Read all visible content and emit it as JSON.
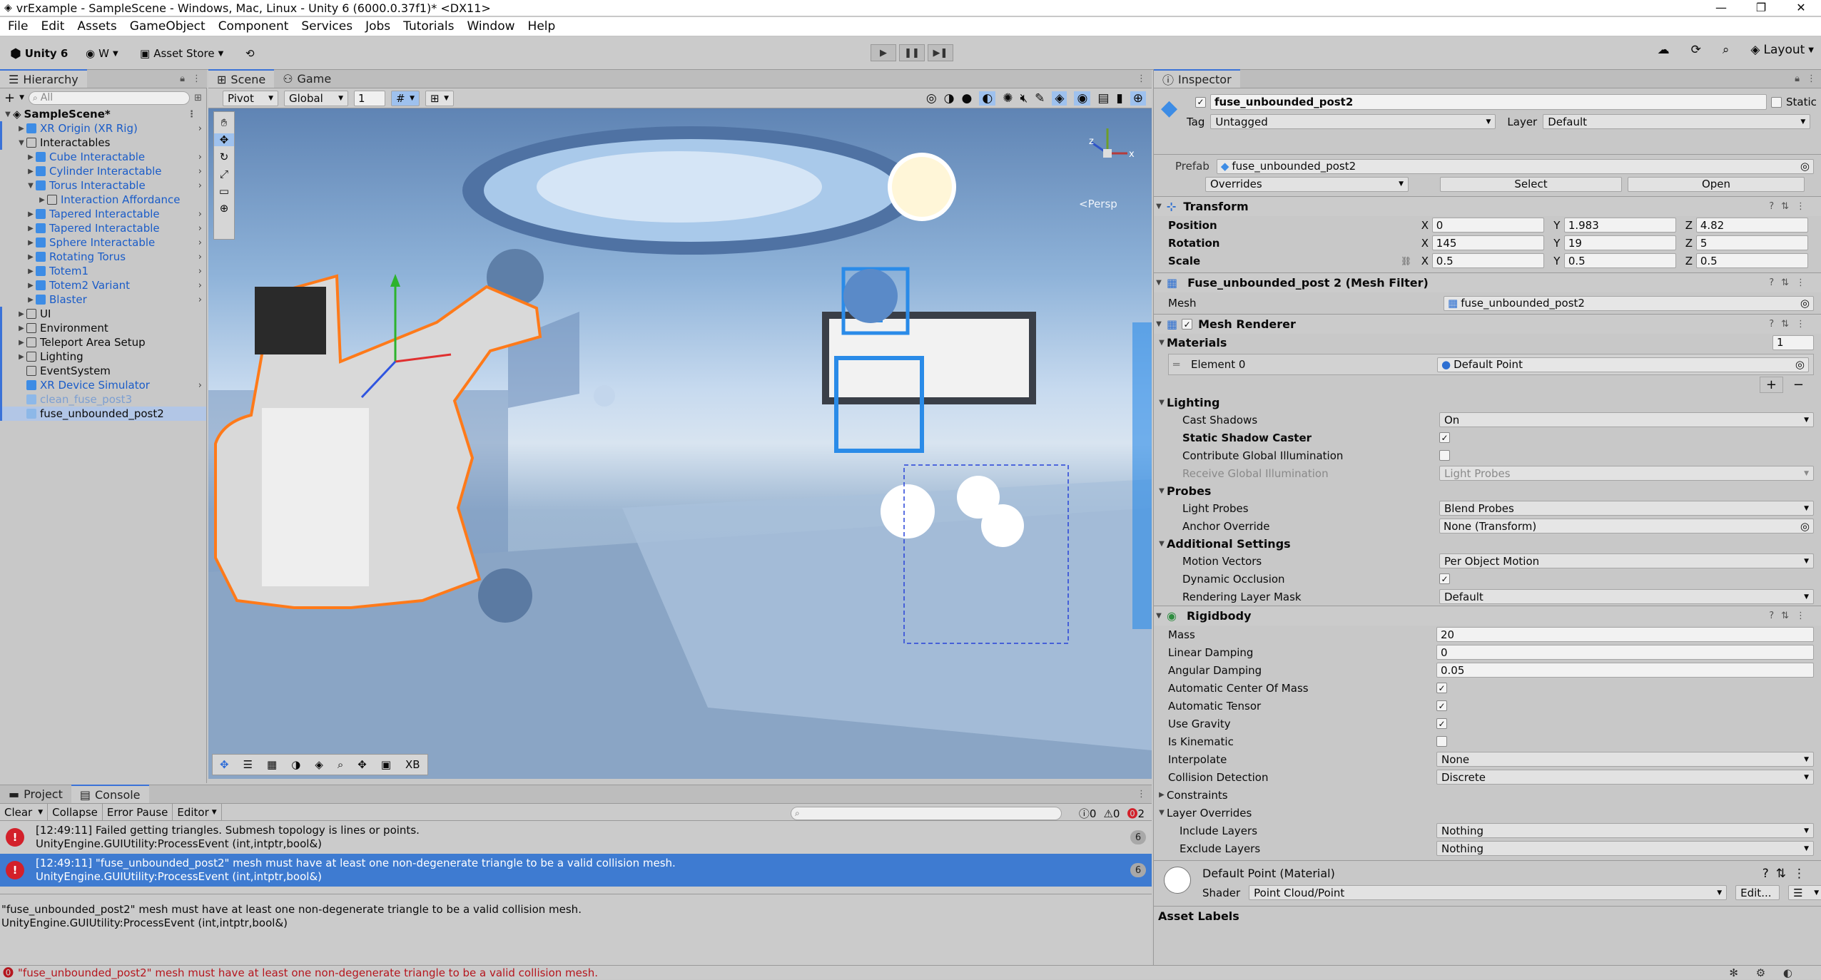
{
  "window": {
    "title": "vrExample - SampleScene - Windows, Mac, Linux - Unity 6 (6000.0.37f1)* <DX11>",
    "min": "—",
    "restore": "❐",
    "close": "✕"
  },
  "menu": [
    "File",
    "Edit",
    "Assets",
    "GameObject",
    "Component",
    "Services",
    "Jobs",
    "Tutorials",
    "Window",
    "Help"
  ],
  "toolbar": {
    "unity": "Unity 6",
    "account": "W",
    "asset_store": "Asset Store",
    "layout": "Layout"
  },
  "hierarchy": {
    "tab": "Hierarchy",
    "search_placeholder": "All",
    "scene": "SampleScene*",
    "rows": [
      {
        "label": "XR Origin (XR Rig)",
        "indent": 1,
        "arrow": "▶",
        "icon": "prefab",
        "blue": true,
        "more": true
      },
      {
        "label": "Interactables",
        "indent": 1,
        "arrow": "▼",
        "icon": "go",
        "blue": false,
        "more": false
      },
      {
        "label": "Cube Interactable",
        "indent": 2,
        "arrow": "▶",
        "icon": "prefab",
        "blue": true,
        "more": true
      },
      {
        "label": "Cylinder Interactable",
        "indent": 2,
        "arrow": "▶",
        "icon": "prefab",
        "blue": true,
        "more": true
      },
      {
        "label": "Torus Interactable",
        "indent": 2,
        "arrow": "▼",
        "icon": "prefab",
        "blue": true,
        "more": true
      },
      {
        "label": "Interaction Affordance",
        "indent": 3,
        "arrow": "▶",
        "icon": "go",
        "blue": true,
        "more": false
      },
      {
        "label": "Tapered Interactable",
        "indent": 2,
        "arrow": "▶",
        "icon": "prefab",
        "blue": true,
        "more": true
      },
      {
        "label": "Tapered Interactable",
        "indent": 2,
        "arrow": "▶",
        "icon": "prefab",
        "blue": true,
        "more": true
      },
      {
        "label": "Sphere Interactable",
        "indent": 2,
        "arrow": "▶",
        "icon": "prefab",
        "blue": true,
        "more": true
      },
      {
        "label": "Rotating Torus",
        "indent": 2,
        "arrow": "▶",
        "icon": "prefab",
        "blue": true,
        "more": true
      },
      {
        "label": "Totem1",
        "indent": 2,
        "arrow": "▶",
        "icon": "prefab",
        "blue": true,
        "more": true
      },
      {
        "label": "Totem2 Variant",
        "indent": 2,
        "arrow": "▶",
        "icon": "prefab",
        "blue": true,
        "more": true
      },
      {
        "label": "Blaster",
        "indent": 2,
        "arrow": "▶",
        "icon": "prefab",
        "blue": true,
        "more": true
      },
      {
        "label": "UI",
        "indent": 1,
        "arrow": "▶",
        "icon": "go",
        "blue": false,
        "more": false
      },
      {
        "label": "Environment",
        "indent": 1,
        "arrow": "▶",
        "icon": "go",
        "blue": false,
        "more": false
      },
      {
        "label": "Teleport Area Setup",
        "indent": 1,
        "arrow": "▶",
        "icon": "go",
        "blue": false,
        "more": false
      },
      {
        "label": "Lighting",
        "indent": 1,
        "arrow": "▶",
        "icon": "go",
        "blue": false,
        "more": false
      },
      {
        "label": "EventSystem",
        "indent": 1,
        "arrow": "",
        "icon": "go",
        "blue": false,
        "more": false
      },
      {
        "label": "XR Device Simulator",
        "indent": 1,
        "arrow": "",
        "icon": "prefab",
        "blue": true,
        "more": true
      },
      {
        "label": "clean_fuse_post3",
        "indent": 1,
        "arrow": "",
        "icon": "fade",
        "blue": true,
        "more": false,
        "faded": true
      },
      {
        "label": "fuse_unbounded_post2",
        "indent": 1,
        "arrow": "",
        "icon": "fade",
        "blue": false,
        "more": false,
        "selected": true
      }
    ]
  },
  "scene": {
    "tab_scene": "Scene",
    "tab_game": "Game",
    "pivot": "Pivot",
    "global": "Global",
    "grid_value": "1",
    "persp": "<Persp",
    "overlay_label": "XB"
  },
  "console": {
    "tab_project": "Project",
    "tab_console": "Console",
    "clear": "Clear",
    "collapse": "Collapse",
    "error_pause": "Error Pause",
    "editor": "Editor",
    "count_info": "0",
    "count_warn": "0",
    "count_err": "2",
    "entries": [
      {
        "line1": "[12:49:11] Failed getting triangles. Submesh topology is lines or points.",
        "line2": "UnityEngine.GUIUtility:ProcessEvent (int,intptr,bool&)",
        "count": "6",
        "selected": false
      },
      {
        "line1": "[12:49:11] \"fuse_unbounded_post2\" mesh must have at least one non-degenerate triangle to be a valid collision mesh.",
        "line2": "UnityEngine.GUIUtility:ProcessEvent (int,intptr,bool&)",
        "count": "6",
        "selected": true
      }
    ],
    "detail1": "\"fuse_unbounded_post2\" mesh must have at least one non-degenerate triangle to be a valid collision mesh.",
    "detail2": "UnityEngine.GUIUtility:ProcessEvent (int,intptr,bool&)",
    "status": "\"fuse_unbounded_post2\" mesh must have at least one non-degenerate triangle to be a valid collision mesh."
  },
  "inspector": {
    "tab": "Inspector",
    "name": "fuse_unbounded_post2",
    "static_label": "Static",
    "tag_label": "Tag",
    "tag": "Untagged",
    "layer_label": "Layer",
    "layer": "Default",
    "prefab_label": "Prefab",
    "prefab": "fuse_unbounded_post2",
    "overrides": "Overrides",
    "select": "Select",
    "open": "Open",
    "transform": {
      "title": "Transform",
      "position_label": "Position",
      "rotation_label": "Rotation",
      "scale_label": "Scale",
      "position": [
        "0",
        "1.983",
        "4.82"
      ],
      "rotation": [
        "145",
        "19",
        "5"
      ],
      "scale": [
        "0.5",
        "0.5",
        "0.5"
      ]
    },
    "mesh_filter": {
      "title": "Fuse_unbounded_post 2 (Mesh Filter)",
      "mesh_label": "Mesh",
      "mesh": "fuse_unbounded_post2"
    },
    "mesh_renderer": {
      "title": "Mesh Renderer",
      "materials_label": "Materials",
      "materials_count": "1",
      "element_label": "Element 0",
      "element": "Default Point",
      "lighting_label": "Lighting",
      "cast_shadows_label": "Cast Shadows",
      "cast_shadows": "On",
      "static_shadow_label": "Static Shadow Caster",
      "contribute_gi_label": "Contribute Global Illumination",
      "receive_gi_label": "Receive Global Illumination",
      "receive_gi": "Light Probes",
      "probes_label": "Probes",
      "light_probes_label": "Light Probes",
      "light_probes": "Blend Probes",
      "anchor_label": "Anchor Override",
      "anchor": "None (Transform)",
      "additional_label": "Additional Settings",
      "motion_label": "Motion Vectors",
      "motion": "Per Object Motion",
      "dynamic_occ_label": "Dynamic Occlusion",
      "rendering_mask_label": "Rendering Layer Mask",
      "rendering_mask": "Default"
    },
    "rigidbody": {
      "title": "Rigidbody",
      "mass_label": "Mass",
      "mass": "20",
      "linear_label": "Linear Damping",
      "linear": "0",
      "angular_label": "Angular Damping",
      "angular": "0.05",
      "auto_com_label": "Automatic Center Of Mass",
      "auto_tensor_label": "Automatic Tensor",
      "gravity_label": "Use Gravity",
      "kinematic_label": "Is Kinematic",
      "interpolate_label": "Interpolate",
      "interpolate": "None",
      "collision_label": "Collision Detection",
      "collision": "Discrete",
      "constraints_label": "Constraints",
      "layer_overrides_label": "Layer Overrides",
      "include_label": "Include Layers",
      "include": "Nothing",
      "exclude_label": "Exclude Layers",
      "exclude": "Nothing"
    },
    "material": {
      "title": "Default Point (Material)",
      "shader_label": "Shader",
      "shader": "Point Cloud/Point",
      "edit": "Edit..."
    },
    "asset_labels": "Asset Labels"
  },
  "colors": {
    "accent": "#3a72d8",
    "selected_row": "#3e7bd1",
    "error": "#d3202a",
    "scene_sky": "#8fb3d9"
  }
}
